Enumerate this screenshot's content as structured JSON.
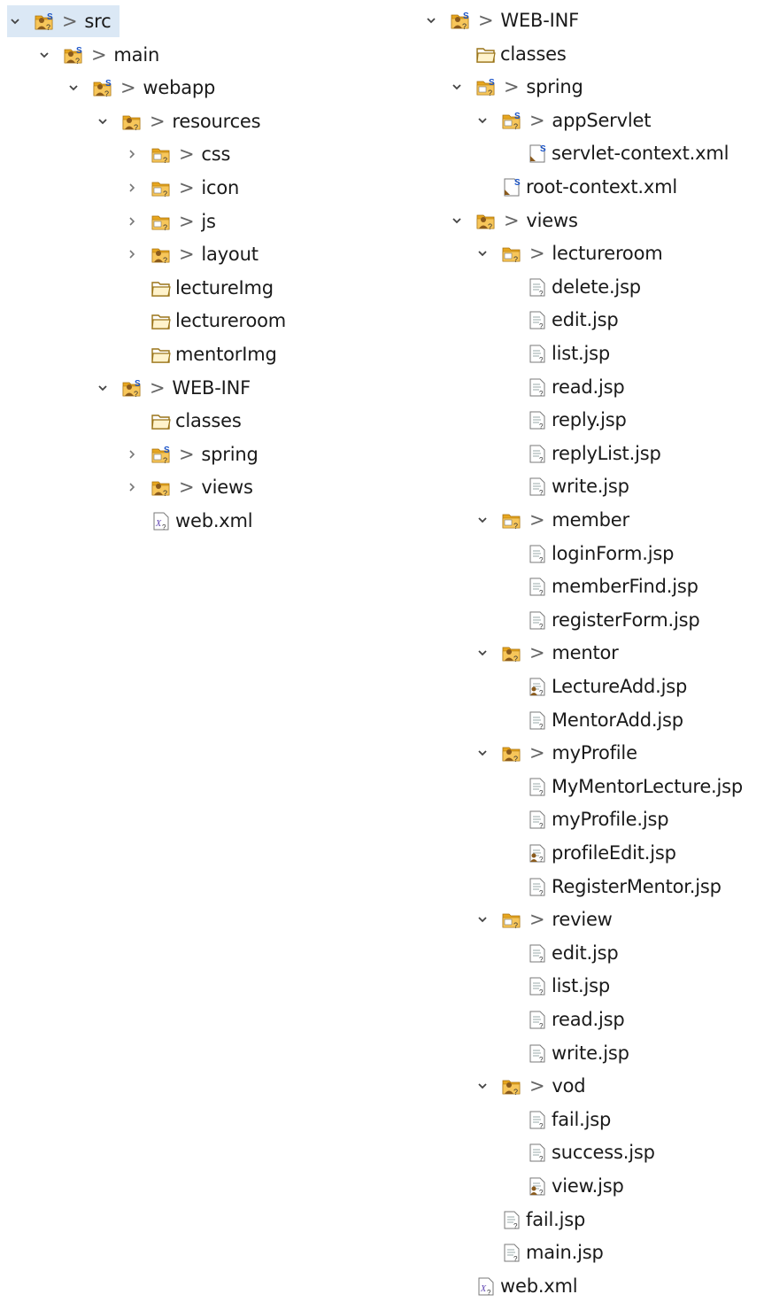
{
  "colors": {
    "selection": "#dbe8f5",
    "folder": "#e8a71f",
    "badge": "#1c55c9",
    "file_border": "#7a7a7a"
  },
  "icons": {
    "expanded": "chevron-down-icon",
    "collapsed": "chevron-right-icon"
  },
  "decoration": ">",
  "left_tree": [
    {
      "id": "src",
      "label": "src",
      "depth": 0,
      "toggle": "expanded",
      "icon": "project-folder",
      "badge": "S",
      "dec": true,
      "selected": true
    },
    {
      "id": "main",
      "label": "main",
      "depth": 1,
      "toggle": "expanded",
      "icon": "project-folder",
      "badge": "S",
      "dec": true
    },
    {
      "id": "webapp",
      "label": "webapp",
      "depth": 2,
      "toggle": "expanded",
      "icon": "project-folder",
      "badge": "S",
      "dec": true
    },
    {
      "id": "resources",
      "label": "resources",
      "depth": 3,
      "toggle": "expanded",
      "icon": "project-folder",
      "badge": "",
      "dec": true
    },
    {
      "id": "css",
      "label": "css",
      "depth": 4,
      "toggle": "collapsed",
      "icon": "folder-q",
      "badge": "",
      "dec": true
    },
    {
      "id": "icon",
      "label": "icon",
      "depth": 4,
      "toggle": "collapsed",
      "icon": "folder-q",
      "badge": "",
      "dec": true
    },
    {
      "id": "js",
      "label": "js",
      "depth": 4,
      "toggle": "collapsed",
      "icon": "folder-q",
      "badge": "",
      "dec": true
    },
    {
      "id": "layout",
      "label": "layout",
      "depth": 4,
      "toggle": "collapsed",
      "icon": "project-folder",
      "badge": "",
      "dec": true
    },
    {
      "id": "lectureImg",
      "label": "lectureImg",
      "depth": 4,
      "toggle": "none",
      "icon": "folder",
      "badge": "",
      "dec": false
    },
    {
      "id": "lectureroom",
      "label": "lectureroom",
      "depth": 4,
      "toggle": "none",
      "icon": "folder",
      "badge": "",
      "dec": false
    },
    {
      "id": "mentorImg",
      "label": "mentorImg",
      "depth": 4,
      "toggle": "none",
      "icon": "folder",
      "badge": "",
      "dec": false
    },
    {
      "id": "web-inf",
      "label": "WEB-INF",
      "depth": 3,
      "toggle": "expanded",
      "icon": "project-folder",
      "badge": "S",
      "dec": true
    },
    {
      "id": "classes",
      "label": "classes",
      "depth": 4,
      "toggle": "none",
      "icon": "folder",
      "badge": "",
      "dec": false
    },
    {
      "id": "spring",
      "label": "spring",
      "depth": 4,
      "toggle": "collapsed",
      "icon": "folder-q",
      "badge": "S",
      "dec": true
    },
    {
      "id": "views",
      "label": "views",
      "depth": 4,
      "toggle": "collapsed",
      "icon": "project-folder",
      "badge": "",
      "dec": true
    },
    {
      "id": "web-xml",
      "label": "web.xml",
      "depth": 4,
      "toggle": "none",
      "icon": "xml-file",
      "badge": "",
      "dec": false
    }
  ],
  "right_tree": [
    {
      "id": "r-web-inf",
      "label": "WEB-INF",
      "depth": 0,
      "toggle": "expanded",
      "icon": "project-folder",
      "badge": "S",
      "dec": true
    },
    {
      "id": "r-classes",
      "label": "classes",
      "depth": 1,
      "toggle": "none",
      "icon": "folder",
      "badge": "",
      "dec": false
    },
    {
      "id": "r-spring",
      "label": "spring",
      "depth": 1,
      "toggle": "expanded",
      "icon": "folder-q",
      "badge": "S",
      "dec": true
    },
    {
      "id": "r-appservlet",
      "label": "appServlet",
      "depth": 2,
      "toggle": "expanded",
      "icon": "folder-q",
      "badge": "S",
      "dec": true
    },
    {
      "id": "r-servlet-context",
      "label": "servlet-context.xml",
      "depth": 3,
      "toggle": "none",
      "icon": "spring-file",
      "badge": "S",
      "dec": false
    },
    {
      "id": "r-root-context",
      "label": "root-context.xml",
      "depth": 2,
      "toggle": "none",
      "icon": "spring-file",
      "badge": "S",
      "dec": false
    },
    {
      "id": "r-views",
      "label": "views",
      "depth": 1,
      "toggle": "expanded",
      "icon": "project-folder",
      "badge": "",
      "dec": true
    },
    {
      "id": "r-lectureroom",
      "label": "lectureroom",
      "depth": 2,
      "toggle": "expanded",
      "icon": "folder-q",
      "badge": "",
      "dec": true
    },
    {
      "id": "r-lr-delete",
      "label": "delete.jsp",
      "depth": 3,
      "toggle": "none",
      "icon": "jsp-file",
      "badge": "",
      "dec": false
    },
    {
      "id": "r-lr-edit",
      "label": "edit.jsp",
      "depth": 3,
      "toggle": "none",
      "icon": "jsp-file",
      "badge": "",
      "dec": false
    },
    {
      "id": "r-lr-list",
      "label": "list.jsp",
      "depth": 3,
      "toggle": "none",
      "icon": "jsp-file",
      "badge": "",
      "dec": false
    },
    {
      "id": "r-lr-read",
      "label": "read.jsp",
      "depth": 3,
      "toggle": "none",
      "icon": "jsp-file",
      "badge": "",
      "dec": false
    },
    {
      "id": "r-lr-reply",
      "label": "reply.jsp",
      "depth": 3,
      "toggle": "none",
      "icon": "jsp-file",
      "badge": "",
      "dec": false
    },
    {
      "id": "r-lr-replylist",
      "label": "replyList.jsp",
      "depth": 3,
      "toggle": "none",
      "icon": "jsp-file",
      "badge": "",
      "dec": false
    },
    {
      "id": "r-lr-write",
      "label": "write.jsp",
      "depth": 3,
      "toggle": "none",
      "icon": "jsp-file",
      "badge": "",
      "dec": false
    },
    {
      "id": "r-member",
      "label": "member",
      "depth": 2,
      "toggle": "expanded",
      "icon": "folder-q",
      "badge": "",
      "dec": true
    },
    {
      "id": "r-m-login",
      "label": "loginForm.jsp",
      "depth": 3,
      "toggle": "none",
      "icon": "jsp-file",
      "badge": "",
      "dec": false
    },
    {
      "id": "r-m-find",
      "label": "memberFind.jsp",
      "depth": 3,
      "toggle": "none",
      "icon": "jsp-file",
      "badge": "",
      "dec": false
    },
    {
      "id": "r-m-register",
      "label": "registerForm.jsp",
      "depth": 3,
      "toggle": "none",
      "icon": "jsp-file",
      "badge": "",
      "dec": false
    },
    {
      "id": "r-mentor",
      "label": "mentor",
      "depth": 2,
      "toggle": "expanded",
      "icon": "project-folder",
      "badge": "",
      "dec": true
    },
    {
      "id": "r-mt-lectureadd",
      "label": "LectureAdd.jsp",
      "depth": 3,
      "toggle": "none",
      "icon": "jsp-file-person",
      "badge": "",
      "dec": false
    },
    {
      "id": "r-mt-mentoradd",
      "label": "MentorAdd.jsp",
      "depth": 3,
      "toggle": "none",
      "icon": "jsp-file",
      "badge": "",
      "dec": false
    },
    {
      "id": "r-myprofile",
      "label": "myProfile",
      "depth": 2,
      "toggle": "expanded",
      "icon": "project-folder",
      "badge": "",
      "dec": true
    },
    {
      "id": "r-mp-mymentorlecture",
      "label": "MyMentorLecture.jsp",
      "depth": 3,
      "toggle": "none",
      "icon": "jsp-file",
      "badge": "",
      "dec": false
    },
    {
      "id": "r-mp-myprofile",
      "label": "myProfile.jsp",
      "depth": 3,
      "toggle": "none",
      "icon": "jsp-file",
      "badge": "",
      "dec": false
    },
    {
      "id": "r-mp-profileedit",
      "label": "profileEdit.jsp",
      "depth": 3,
      "toggle": "none",
      "icon": "jsp-file-person",
      "badge": "",
      "dec": false
    },
    {
      "id": "r-mp-registermentor",
      "label": "RegisterMentor.jsp",
      "depth": 3,
      "toggle": "none",
      "icon": "jsp-file",
      "badge": "",
      "dec": false
    },
    {
      "id": "r-review",
      "label": "review",
      "depth": 2,
      "toggle": "expanded",
      "icon": "folder-q",
      "badge": "",
      "dec": true
    },
    {
      "id": "r-rv-edit",
      "label": "edit.jsp",
      "depth": 3,
      "toggle": "none",
      "icon": "jsp-file",
      "badge": "",
      "dec": false
    },
    {
      "id": "r-rv-list",
      "label": "list.jsp",
      "depth": 3,
      "toggle": "none",
      "icon": "jsp-file",
      "badge": "",
      "dec": false
    },
    {
      "id": "r-rv-read",
      "label": "read.jsp",
      "depth": 3,
      "toggle": "none",
      "icon": "jsp-file",
      "badge": "",
      "dec": false
    },
    {
      "id": "r-rv-write",
      "label": "write.jsp",
      "depth": 3,
      "toggle": "none",
      "icon": "jsp-file",
      "badge": "",
      "dec": false
    },
    {
      "id": "r-vod",
      "label": "vod",
      "depth": 2,
      "toggle": "expanded",
      "icon": "project-folder",
      "badge": "",
      "dec": true
    },
    {
      "id": "r-vod-fail",
      "label": "fail.jsp",
      "depth": 3,
      "toggle": "none",
      "icon": "jsp-file",
      "badge": "",
      "dec": false
    },
    {
      "id": "r-vod-success",
      "label": "success.jsp",
      "depth": 3,
      "toggle": "none",
      "icon": "jsp-file",
      "badge": "",
      "dec": false
    },
    {
      "id": "r-vod-view",
      "label": "view.jsp",
      "depth": 3,
      "toggle": "none",
      "icon": "jsp-file-person",
      "badge": "",
      "dec": false
    },
    {
      "id": "r-fail",
      "label": "fail.jsp",
      "depth": 2,
      "toggle": "none",
      "icon": "jsp-file",
      "badge": "",
      "dec": false
    },
    {
      "id": "r-main",
      "label": "main.jsp",
      "depth": 2,
      "toggle": "none",
      "icon": "jsp-file",
      "badge": "",
      "dec": false
    },
    {
      "id": "r-web-xml",
      "label": "web.xml",
      "depth": 1,
      "toggle": "none",
      "icon": "xml-file",
      "badge": "",
      "dec": false
    }
  ]
}
